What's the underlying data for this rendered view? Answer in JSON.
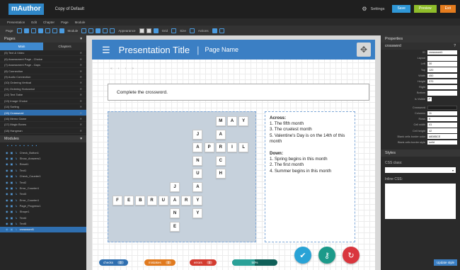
{
  "app": {
    "logo": "mAuthor",
    "doc_title": "Copy of Default",
    "settings_label": "Settings",
    "save_label": "Save",
    "preview_label": "Preview",
    "exit_label": "Exit",
    "colors": {
      "save": "#2f97d6",
      "preview": "#8fbd2a",
      "exit": "#e57c1e",
      "accent": "#3b7fc4"
    }
  },
  "menu": [
    "Presentation",
    "Edit",
    "Chapter",
    "Page",
    "Module"
  ],
  "toolbar": {
    "page_label": "Page",
    "module_label": "Module",
    "appearance_label": "Appearance",
    "grid_label": "Grid",
    "size_label": "Size",
    "actions_label": "Actions"
  },
  "left": {
    "pages_title": "Pages",
    "tabs": [
      "Main",
      "Chapters"
    ],
    "pages": [
      "(5) Text & Video",
      "(6) Assessment Page - Choice",
      "(7) Assessment Page - Gaps",
      "(8) Connection",
      "(9) Audio Connection",
      "(10) Ordering Vertical",
      "(11) Ordering Horizontal",
      "(12) Text Table",
      "(13) Image Choice",
      "(14) Sorting",
      "(15) Crossword",
      "(16) Memo Game",
      "(17) Magic Boxes",
      "(18) Hangman"
    ],
    "selected_page": 10,
    "modules_title": "Modules",
    "modules": [
      "Check_Button1",
      "Show_Answers1",
      "Reset1",
      "Text1",
      "Check_Counter1",
      "Text2",
      "Error_Counter1",
      "Text3",
      "Error_Counter1",
      "Page_Progress1",
      "Shape1",
      "Text4",
      "Text5",
      "crossword1"
    ],
    "selected_module": 13
  },
  "slide": {
    "title": "Presentation Title",
    "separator": "|",
    "page_name": "Page Name",
    "instruction": "Complete the crossword.",
    "nav": [
      "«",
      "‹",
      "›",
      "»"
    ]
  },
  "crossword": {
    "cells": [
      {
        "r": 0,
        "c": 9,
        "l": "M"
      },
      {
        "r": 0,
        "c": 10,
        "l": "A"
      },
      {
        "r": 0,
        "c": 11,
        "l": "Y"
      },
      {
        "r": 1,
        "c": 7,
        "l": "J"
      },
      {
        "r": 1,
        "c": 9,
        "l": "A"
      },
      {
        "r": 2,
        "c": 7,
        "l": "A"
      },
      {
        "r": 2,
        "c": 8,
        "l": "P"
      },
      {
        "r": 2,
        "c": 9,
        "l": "R"
      },
      {
        "r": 2,
        "c": 10,
        "l": "I"
      },
      {
        "r": 2,
        "c": 11,
        "l": "L"
      },
      {
        "r": 3,
        "c": 7,
        "l": "N"
      },
      {
        "r": 3,
        "c": 9,
        "l": "C"
      },
      {
        "r": 4,
        "c": 7,
        "l": "U"
      },
      {
        "r": 4,
        "c": 9,
        "l": "H"
      },
      {
        "r": 5,
        "c": 5,
        "l": "J"
      },
      {
        "r": 5,
        "c": 7,
        "l": "A"
      },
      {
        "r": 6,
        "c": 0,
        "l": "F"
      },
      {
        "r": 6,
        "c": 1,
        "l": "E"
      },
      {
        "r": 6,
        "c": 2,
        "l": "B"
      },
      {
        "r": 6,
        "c": 3,
        "l": "R"
      },
      {
        "r": 6,
        "c": 4,
        "l": "U"
      },
      {
        "r": 6,
        "c": 5,
        "l": "A"
      },
      {
        "r": 6,
        "c": 6,
        "l": "R"
      },
      {
        "r": 6,
        "c": 7,
        "l": "Y"
      },
      {
        "r": 7,
        "c": 5,
        "l": "N"
      },
      {
        "r": 7,
        "c": 7,
        "l": "Y"
      },
      {
        "r": 8,
        "c": 5,
        "l": "E"
      }
    ]
  },
  "clues": {
    "across_title": "Across:",
    "across": [
      "1. The fifth month",
      "3. The cruelest month",
      "5. Valentine's Day is on the 14th of this month"
    ],
    "down_title": "Down:",
    "down": [
      "1. Spring begins in this month",
      "2. The first month",
      "4. Summer begins in this month"
    ]
  },
  "status": {
    "checks_label": "checks",
    "checks_count": "0",
    "mistakes_label": "mistakes",
    "mistakes_count": "0",
    "errors_label": "errors",
    "errors_count": "0",
    "progress_label": "50%",
    "progress": 0.5,
    "colors": {
      "checks": "#2f6fb0",
      "mistakes": "#e07a1f",
      "errors": "#d33b2f",
      "progress": "#2aa198"
    }
  },
  "fabs": {
    "check_icon": "check-icon",
    "show_icon": "key-icon",
    "reset_icon": "refresh-icon",
    "colors": {
      "check": "#29a3d6",
      "show": "#1c9a8a",
      "reset": "#d9363e"
    }
  },
  "props": {
    "title": "Properties",
    "module": "crossword",
    "rows": [
      {
        "label": "ID",
        "value": "crossword1"
      },
      {
        "label": "Layout",
        "value": ""
      },
      {
        "label": "Left",
        "value": "30"
      },
      {
        "label": "Top",
        "value": "120"
      },
      {
        "label": "Width",
        "value": "450"
      },
      {
        "label": "Height",
        "value": "370"
      },
      {
        "label": "Right",
        "value": ""
      },
      {
        "label": "Bottom",
        "value": ""
      }
    ],
    "visible_label": "Is Visible",
    "rows2": [
      {
        "label": "Crossword",
        "value": ""
      },
      {
        "label": "Columns",
        "value": "11"
      },
      {
        "label": "Rows",
        "value": "9"
      },
      {
        "label": "Cell width",
        "value": "41"
      },
      {
        "label": "Cell height",
        "value": "42"
      },
      {
        "label": "Blank cells border color",
        "value": "#808BCE"
      },
      {
        "label": "Blank cells border style",
        "value": "solid"
      }
    ]
  },
  "styles": {
    "title": "Styles",
    "css_class_label": "CSS class:",
    "inline_label": "Inline CSS:",
    "update_label": "Update style"
  }
}
